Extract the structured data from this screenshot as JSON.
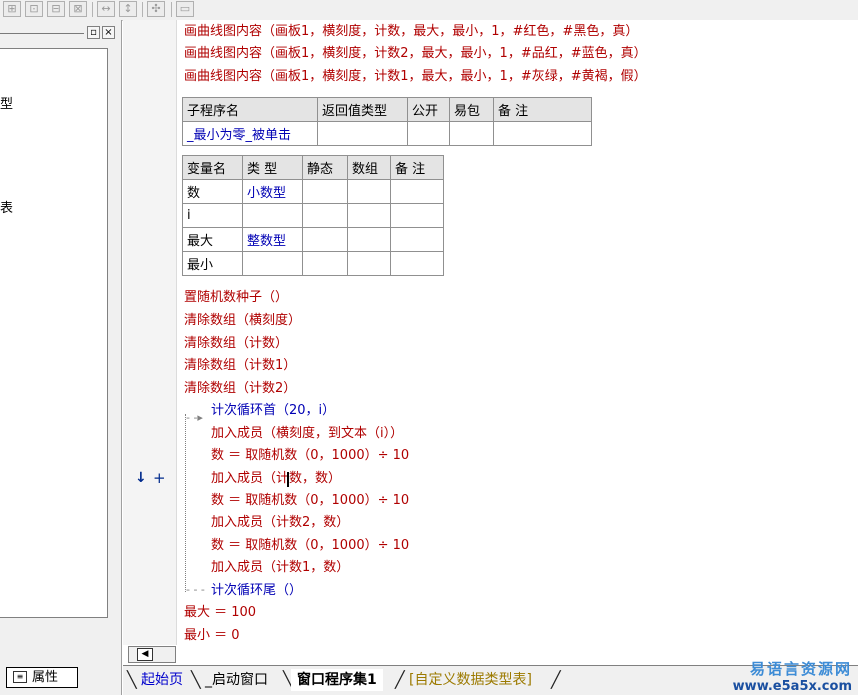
{
  "toolbar": {
    "icons": [
      "grid-icon",
      "grid-icon",
      "grid-icon",
      "grid-icon",
      "split-h-icon",
      "split-v-icon",
      "crosshair-icon"
    ]
  },
  "left_panel": {
    "cut_text_1": "型",
    "cut_text_2": "表",
    "properties_tab": "属性"
  },
  "code": {
    "draw_lines": [
      "画曲线图内容（画板1，横刻度，计数，最大，最小，1，#红色，#黑色，真）",
      "画曲线图内容（画板1，横刻度，计数2，最大，最小，1，#品红，#蓝色，真）",
      "画曲线图内容（画板1，横刻度，计数1，最大，最小，1，#灰绿，#黄褐，假）"
    ],
    "sub_table": {
      "headers": [
        "子程序名",
        "返回值类型",
        "公开",
        "易包",
        "备 注"
      ],
      "row": [
        "_最小为零_被单击",
        "",
        "",
        "",
        ""
      ]
    },
    "var_table": {
      "headers": [
        "变量名",
        "类 型",
        "静态",
        "数组",
        "备 注"
      ],
      "rows": [
        [
          "数",
          "小数型",
          "",
          "",
          ""
        ],
        [
          "i",
          "",
          "",
          "",
          ""
        ],
        [
          "最大",
          "整数型",
          "",
          "",
          ""
        ],
        [
          "最小",
          "",
          "",
          "",
          ""
        ]
      ]
    },
    "stmt_random_seed": "置随机数种子（）",
    "stmt_clear_1": "清除数组（横刻度）",
    "stmt_clear_2": "清除数组（计数）",
    "stmt_clear_3": "清除数组（计数1）",
    "stmt_clear_4": "清除数组（计数2）",
    "loop_head": "计次循环首（20，i）",
    "loop_body": [
      "加入成员（横刻度，到文本（i））",
      "数 ＝ 取随机数（0，1000）÷ 10",
      "加入成员（计数，数）",
      "数 ＝ 取随机数（0，1000）÷ 10",
      "加入成员（计数2，数）",
      "数 ＝ 取随机数（0，1000）÷ 10",
      "加入成员（计数1，数）"
    ],
    "loop_tail": "计次循环尾（）",
    "assign_max": "最大 ＝ 100",
    "assign_min": "最小 ＝ 0"
  },
  "gutter": {
    "arrow": "↓",
    "plus": "+"
  },
  "tabs": [
    {
      "label": "起始页"
    },
    {
      "label": "_启动窗口"
    },
    {
      "label": "窗口程序集1"
    },
    {
      "label": "[自定义数据类型表]"
    }
  ],
  "watermark": {
    "line1": "易语言资源网",
    "line2": "www.e5a5x.com"
  }
}
